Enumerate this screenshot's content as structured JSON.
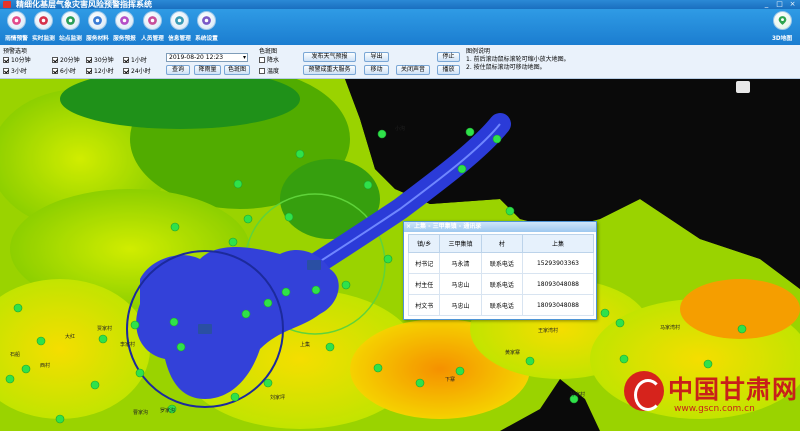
{
  "app": {
    "title": "精细化基层气象灾害风险预警指挥系统",
    "window_buttons": [
      "_",
      "□",
      "×"
    ]
  },
  "nav": {
    "items": [
      {
        "label": "雨情预警",
        "icon": "rain-icon",
        "color": "#e24b8b"
      },
      {
        "label": "实时监测",
        "icon": "monitor-icon",
        "color": "#d6314b"
      },
      {
        "label": "站点监测",
        "icon": "station-icon",
        "color": "#2a9d59"
      },
      {
        "label": "服务材料",
        "icon": "document-icon",
        "color": "#3a7bd5"
      },
      {
        "label": "服务预报",
        "icon": "forecast-icon",
        "color": "#b44fc7"
      },
      {
        "label": "人员管理",
        "icon": "people-icon",
        "color": "#c74f9a"
      },
      {
        "label": "信息管理",
        "icon": "info-icon",
        "color": "#3a9bb5"
      },
      {
        "label": "系统设置",
        "icon": "gear-icon",
        "color": "#7a59c7"
      }
    ],
    "right": {
      "label": "3D地图",
      "icon": "map-pin-icon",
      "color": "#2ea44f"
    }
  },
  "controls": {
    "section_title": "预警选项",
    "checkboxes": [
      {
        "label": "10分钟",
        "checked": true
      },
      {
        "label": "20分钟",
        "checked": true
      },
      {
        "label": "30分钟",
        "checked": true
      },
      {
        "label": "1小时",
        "checked": true
      },
      {
        "label": "3小时",
        "checked": true
      },
      {
        "label": "6小时",
        "checked": true
      },
      {
        "label": "12小时",
        "checked": true
      },
      {
        "label": "24小时",
        "checked": true
      }
    ],
    "datetime": "2019-08-20 12:23",
    "query_label": "查询",
    "rainfall_label": "降雨量",
    "hail_label": "色斑图",
    "layer_title": "色斑图",
    "layers": [
      {
        "label": "降水",
        "checked": false
      },
      {
        "label": "温度",
        "checked": false
      }
    ],
    "publish_label": "发布天气预报",
    "amplify_label": "预警成重大服务",
    "export_label": "导出",
    "move_label": "移动",
    "close_sound_label": "关闭声音",
    "stop_label": "停止",
    "play_label": "播放"
  },
  "legend": {
    "title": "图例说明",
    "lines": [
      "1. 前后滚动鼠标滚轮可缩小放大地图。",
      "2. 按住鼠标滚动可移动地图。"
    ]
  },
  "map": {
    "towns": [
      {
        "name": "小沟"
      },
      {
        "name": "大红"
      },
      {
        "name": "石船"
      },
      {
        "name": "西村"
      },
      {
        "name": "贾家村"
      },
      {
        "name": "李家村"
      },
      {
        "name": "罗家沟"
      },
      {
        "name": "曹家沟"
      },
      {
        "name": "马家湾村"
      },
      {
        "name": "王家湾村"
      },
      {
        "name": "黄家寨"
      },
      {
        "name": "孙家村"
      },
      {
        "name": "刘家坪"
      },
      {
        "name": "下寨"
      },
      {
        "name": "上集"
      }
    ]
  },
  "popup": {
    "title": "上集 - 三甲集镇 - 通讯录",
    "headers": [
      "镇/乡",
      "三甲集镇",
      "村",
      "上集"
    ],
    "rows": [
      [
        "村书记",
        "马永清",
        "联系电话",
        "15293903363"
      ],
      [
        "村主任",
        "马忠山",
        "联系电话",
        "18093048088"
      ],
      [
        "村文书",
        "马忠山",
        "联系电话",
        "18093048088"
      ]
    ]
  },
  "watermark": {
    "title": "中国甘肃网",
    "url": "www.gscn.com.cn"
  }
}
